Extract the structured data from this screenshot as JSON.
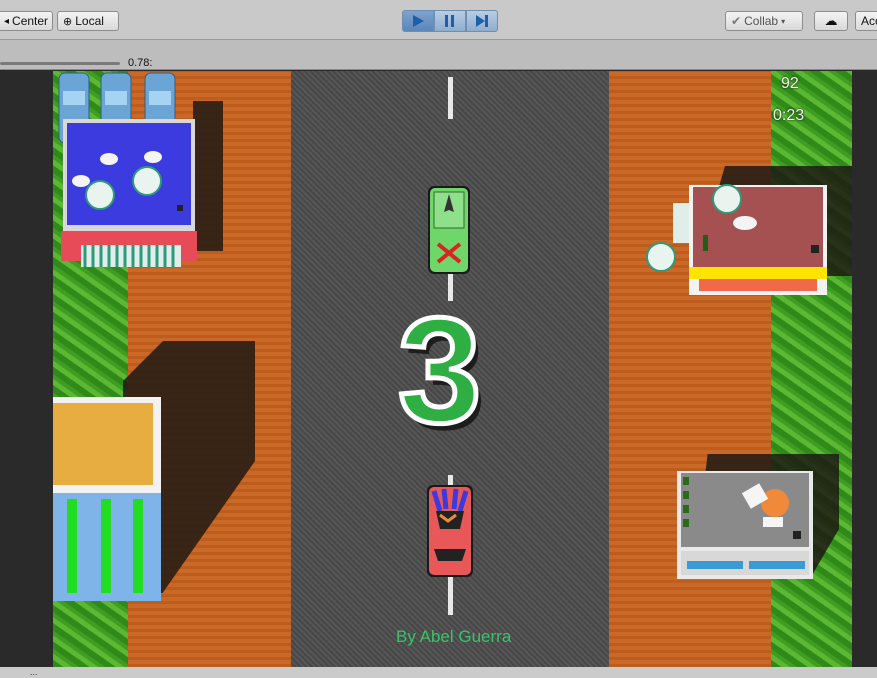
{
  "toolbar": {
    "pivot_label": "Center",
    "space_label": "Local",
    "collab_label": "Collab",
    "account_label": "Acc"
  },
  "scale": {
    "value_label": "0.78:"
  },
  "hud": {
    "score": "92",
    "timer": "0:23"
  },
  "countdown": "3",
  "credit": "By Abel Guerra",
  "status": "..."
}
